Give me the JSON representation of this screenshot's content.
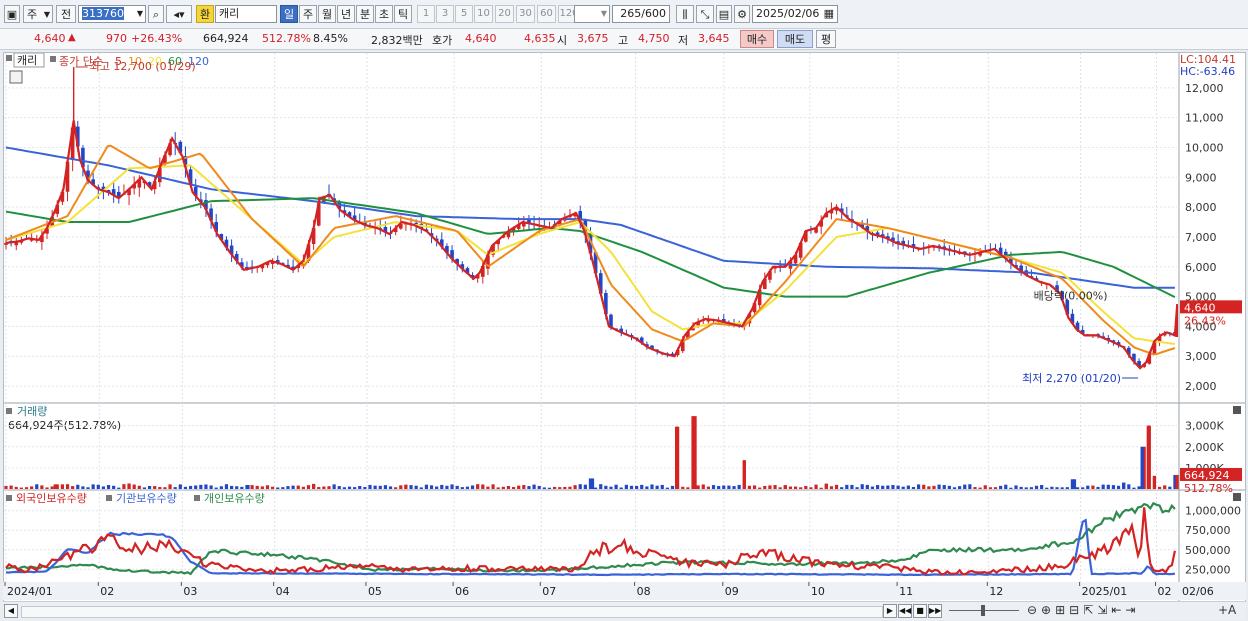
{
  "toolbar": {
    "market": "주",
    "scope": "전",
    "code": "313760",
    "currency": "환",
    "name": "캐리",
    "periods": [
      "일",
      "주",
      "월",
      "년",
      "분",
      "초",
      "틱"
    ],
    "active_period": "일",
    "minutes": [
      "1",
      "3",
      "5",
      "10",
      "20",
      "30",
      "60",
      "120"
    ],
    "count": "265",
    "count_total": "/600",
    "date": "2025/02/06"
  },
  "price_row": {
    "price": "4,640",
    "change": "970",
    "change_pct": "+26.43%",
    "volume": "664,924",
    "volume_pct": "512.78%",
    "turnover": "8.45%",
    "amount": "2,832백만",
    "quote_label": "호가",
    "ask": "4,640",
    "bid": "4,635",
    "open_label": "시",
    "open": "3,675",
    "high_label": "고",
    "high": "4,750",
    "low_label": "저",
    "low": "3,645",
    "buy": "매수",
    "sell": "매도",
    "eval": "평"
  },
  "chart_data": [
    {
      "type": "line",
      "title": "캐리",
      "legend_label": "종가 단순",
      "ma_periods": [
        "5",
        "10",
        "20",
        "60",
        "120"
      ],
      "colors": {
        "ma5": "#d32323",
        "ma10": "#f08a1c",
        "ma20": "#f4e23a",
        "ma60": "#209040",
        "ma120": "#3a63d8",
        "up": "#d32323",
        "down": "#1f47c8"
      },
      "ylim": [
        1600,
        12900
      ],
      "y_ticks": [
        "12,000",
        "11,000",
        "10,000",
        "9,000",
        "8,000",
        "7,000",
        "6,000",
        "5,000",
        "4,000",
        "3,000",
        "2,000"
      ],
      "y_tick_values": [
        12000,
        11000,
        10000,
        9000,
        8000,
        7000,
        6000,
        5000,
        4000,
        3000,
        2000
      ],
      "x_labels": [
        "2024/01",
        "02",
        "03",
        "04",
        "05",
        "06",
        "07",
        "08",
        "09",
        "10",
        "11",
        "12",
        "2025/01",
        "02",
        "02/06"
      ],
      "lc": "LC:104.41",
      "hc": "HC:-63.46",
      "last_price": "4,640",
      "last_pct": "26.43%",
      "max_annotation": "최고 12,700 (01/29)",
      "min_annotation": "최저 2,270 (01/20)",
      "dividend_annotation": "배당락(0.00%)",
      "close_keys": [
        [
          0,
          6800
        ],
        [
          12,
          6850
        ],
        [
          22,
          6950
        ],
        [
          32,
          6900
        ],
        [
          40,
          7300
        ],
        [
          48,
          7900
        ],
        [
          56,
          8600
        ],
        [
          66,
          10900
        ],
        [
          72,
          9600
        ],
        [
          80,
          8900
        ],
        [
          90,
          8600
        ],
        [
          100,
          8500
        ],
        [
          110,
          8300
        ],
        [
          120,
          8600
        ],
        [
          132,
          9000
        ],
        [
          142,
          8600
        ],
        [
          152,
          9500
        ],
        [
          162,
          10300
        ],
        [
          172,
          9700
        ],
        [
          182,
          8500
        ],
        [
          194,
          8000
        ],
        [
          206,
          7100
        ],
        [
          218,
          6500
        ],
        [
          232,
          5900
        ],
        [
          246,
          6000
        ],
        [
          258,
          6200
        ],
        [
          268,
          6100
        ],
        [
          280,
          5900
        ],
        [
          290,
          6200
        ],
        [
          300,
          7300
        ],
        [
          306,
          8300
        ],
        [
          316,
          8400
        ],
        [
          326,
          7900
        ],
        [
          338,
          7600
        ],
        [
          350,
          7400
        ],
        [
          362,
          7300
        ],
        [
          374,
          7100
        ],
        [
          386,
          7500
        ],
        [
          398,
          7400
        ],
        [
          410,
          7200
        ],
        [
          422,
          6800
        ],
        [
          434,
          6300
        ],
        [
          446,
          5900
        ],
        [
          456,
          5600
        ],
        [
          462,
          5800
        ],
        [
          474,
          6700
        ],
        [
          490,
          7200
        ],
        [
          504,
          7500
        ],
        [
          518,
          7400
        ],
        [
          532,
          7300
        ],
        [
          542,
          7600
        ],
        [
          556,
          7800
        ],
        [
          564,
          7200
        ],
        [
          572,
          6200
        ],
        [
          580,
          5100
        ],
        [
          588,
          4000
        ],
        [
          600,
          3800
        ],
        [
          614,
          3600
        ],
        [
          626,
          3300
        ],
        [
          640,
          3100
        ],
        [
          652,
          3000
        ],
        [
          662,
          3700
        ],
        [
          672,
          4100
        ],
        [
          682,
          4250
        ],
        [
          694,
          4200
        ],
        [
          706,
          4100
        ],
        [
          718,
          4000
        ],
        [
          728,
          4600
        ],
        [
          738,
          5500
        ],
        [
          748,
          6000
        ],
        [
          760,
          6000
        ],
        [
          770,
          6400
        ],
        [
          780,
          7200
        ],
        [
          790,
          7300
        ],
        [
          800,
          7800
        ],
        [
          810,
          8000
        ],
        [
          822,
          7600
        ],
        [
          832,
          7400
        ],
        [
          844,
          7100
        ],
        [
          856,
          7000
        ],
        [
          868,
          6800
        ],
        [
          880,
          6700
        ],
        [
          892,
          6600
        ],
        [
          904,
          6700
        ],
        [
          916,
          6600
        ],
        [
          928,
          6500
        ],
        [
          940,
          6400
        ],
        [
          952,
          6500
        ],
        [
          964,
          6600
        ],
        [
          974,
          6300
        ],
        [
          984,
          6000
        ],
        [
          996,
          5700
        ],
        [
          1008,
          5500
        ],
        [
          1018,
          5400
        ],
        [
          1028,
          5100
        ],
        [
          1036,
          4300
        ],
        [
          1044,
          3900
        ],
        [
          1052,
          3700
        ],
        [
          1064,
          3700
        ],
        [
          1078,
          3500
        ],
        [
          1090,
          3300
        ],
        [
          1098,
          2900
        ],
        [
          1106,
          2600
        ],
        [
          1112,
          2800
        ],
        [
          1120,
          3500
        ],
        [
          1126,
          3700
        ],
        [
          1132,
          3800
        ],
        [
          1140,
          3700
        ],
        [
          1142,
          4640
        ]
      ],
      "ma120_keys": [
        [
          0,
          10000
        ],
        [
          100,
          9400
        ],
        [
          200,
          8600
        ],
        [
          300,
          8200
        ],
        [
          400,
          7700
        ],
        [
          500,
          7600
        ],
        [
          560,
          7600
        ],
        [
          600,
          7400
        ],
        [
          700,
          6200
        ],
        [
          800,
          6000
        ],
        [
          900,
          5950
        ],
        [
          1000,
          5800
        ],
        [
          1100,
          5300
        ],
        [
          1142,
          5300
        ]
      ],
      "ma60_keys": [
        [
          0,
          7850
        ],
        [
          60,
          7500
        ],
        [
          120,
          7500
        ],
        [
          200,
          8200
        ],
        [
          300,
          8300
        ],
        [
          400,
          7800
        ],
        [
          470,
          7100
        ],
        [
          530,
          7300
        ],
        [
          560,
          7200
        ],
        [
          620,
          6500
        ],
        [
          700,
          5300
        ],
        [
          760,
          5000
        ],
        [
          820,
          5000
        ],
        [
          900,
          5800
        ],
        [
          980,
          6400
        ],
        [
          1030,
          6500
        ],
        [
          1080,
          6000
        ],
        [
          1142,
          4950
        ]
      ],
      "ma20_keys": [
        [
          0,
          6900
        ],
        [
          60,
          7500
        ],
        [
          120,
          9300
        ],
        [
          180,
          9400
        ],
        [
          240,
          7600
        ],
        [
          290,
          6100
        ],
        [
          320,
          7000
        ],
        [
          380,
          7500
        ],
        [
          440,
          7200
        ],
        [
          470,
          6400
        ],
        [
          520,
          7100
        ],
        [
          560,
          7500
        ],
        [
          590,
          6500
        ],
        [
          630,
          4500
        ],
        [
          660,
          3900
        ],
        [
          690,
          4100
        ],
        [
          720,
          4100
        ],
        [
          760,
          5200
        ],
        [
          810,
          7000
        ],
        [
          860,
          7300
        ],
        [
          920,
          6800
        ],
        [
          980,
          6300
        ],
        [
          1030,
          5800
        ],
        [
          1070,
          4500
        ],
        [
          1100,
          3600
        ],
        [
          1142,
          3400
        ]
      ],
      "ma10_keys": [
        [
          0,
          6900
        ],
        [
          60,
          7700
        ],
        [
          100,
          10100
        ],
        [
          140,
          9300
        ],
        [
          190,
          9800
        ],
        [
          240,
          7600
        ],
        [
          290,
          6000
        ],
        [
          320,
          7300
        ],
        [
          380,
          7700
        ],
        [
          440,
          7200
        ],
        [
          470,
          6000
        ],
        [
          520,
          7200
        ],
        [
          560,
          7600
        ],
        [
          590,
          5400
        ],
        [
          630,
          3900
        ],
        [
          660,
          3500
        ],
        [
          690,
          4100
        ],
        [
          720,
          4000
        ],
        [
          760,
          5500
        ],
        [
          810,
          7600
        ],
        [
          860,
          7300
        ],
        [
          920,
          6800
        ],
        [
          980,
          6300
        ],
        [
          1030,
          5600
        ],
        [
          1070,
          4200
        ],
        [
          1100,
          3300
        ],
        [
          1120,
          3050
        ],
        [
          1142,
          3300
        ]
      ]
    },
    {
      "type": "bar",
      "title": "거래량",
      "volume_readout": "664,924주(512.78%)",
      "ylim": [
        0,
        3600
      ],
      "y_ticks": [
        "3,000K",
        "2,000K",
        "1,000K"
      ],
      "y_tick_values": [
        3000,
        2000,
        1000
      ],
      "last_label": "664,924",
      "last_pct": "512.78%",
      "spikes": [
        [
          48,
          220
        ],
        [
          120,
          260
        ],
        [
          236,
          190
        ],
        [
          300,
          240
        ],
        [
          390,
          200
        ],
        [
          572,
          500
        ],
        [
          654,
          2950
        ],
        [
          672,
          3450
        ],
        [
          720,
          1360
        ],
        [
          760,
          180
        ],
        [
          800,
          250
        ],
        [
          1042,
          460
        ],
        [
          1090,
          300
        ],
        [
          1108,
          2000
        ],
        [
          1114,
          3000
        ],
        [
          1120,
          620
        ],
        [
          1142,
          665
        ]
      ]
    },
    {
      "type": "line",
      "series_names": [
        "외국인보유수량",
        "기관보유수량",
        "개인보유수량"
      ],
      "colors": {
        "foreign": "#d32323",
        "inst": "#3a63d8",
        "indiv": "#2f8a4f"
      },
      "ylim": [
        100000,
        1150000
      ],
      "y_ticks": [
        "1,000,000",
        "750,000",
        "500,000",
        "250,000"
      ],
      "y_tick_values": [
        1000000,
        750000,
        500000,
        250000
      ],
      "foreign_keys": [
        [
          0,
          290000
        ],
        [
          20,
          240000
        ],
        [
          40,
          300000
        ],
        [
          60,
          420000
        ],
        [
          80,
          520000
        ],
        [
          100,
          620000
        ],
        [
          120,
          500000
        ],
        [
          140,
          520000
        ],
        [
          160,
          560000
        ],
        [
          180,
          410000
        ],
        [
          200,
          300000
        ],
        [
          220,
          280000
        ],
        [
          260,
          230000
        ],
        [
          300,
          250000
        ],
        [
          340,
          290000
        ],
        [
          400,
          240000
        ],
        [
          440,
          260000
        ],
        [
          500,
          250000
        ],
        [
          560,
          250000
        ],
        [
          575,
          500000
        ],
        [
          600,
          550000
        ],
        [
          640,
          410000
        ],
        [
          660,
          340000
        ],
        [
          700,
          300000
        ],
        [
          720,
          420000
        ],
        [
          740,
          470000
        ],
        [
          760,
          420000
        ],
        [
          800,
          300000
        ],
        [
          850,
          290000
        ],
        [
          900,
          220000
        ],
        [
          950,
          200000
        ],
        [
          1000,
          260000
        ],
        [
          1030,
          300000
        ],
        [
          1050,
          400000
        ],
        [
          1070,
          490000
        ],
        [
          1085,
          600000
        ],
        [
          1095,
          730000
        ],
        [
          1100,
          800000
        ],
        [
          1105,
          400000
        ],
        [
          1110,
          940000
        ],
        [
          1115,
          310000
        ],
        [
          1120,
          260000
        ],
        [
          1130,
          230000
        ],
        [
          1138,
          270000
        ],
        [
          1142,
          800000
        ]
      ],
      "inst_keys": [
        [
          0,
          210000
        ],
        [
          40,
          220000
        ],
        [
          60,
          500000
        ],
        [
          80,
          460000
        ],
        [
          100,
          700000
        ],
        [
          130,
          700000
        ],
        [
          160,
          680000
        ],
        [
          180,
          350000
        ],
        [
          200,
          200000
        ],
        [
          400,
          190000
        ],
        [
          600,
          180000
        ],
        [
          700,
          190000
        ],
        [
          900,
          180000
        ],
        [
          1040,
          190000
        ],
        [
          1052,
          1000000
        ],
        [
          1058,
          190000
        ],
        [
          1108,
          200000
        ],
        [
          1114,
          300000
        ],
        [
          1120,
          190000
        ],
        [
          1142,
          190000
        ]
      ],
      "indiv_keys": [
        [
          0,
          260000
        ],
        [
          40,
          280000
        ],
        [
          80,
          300000
        ],
        [
          120,
          230000
        ],
        [
          180,
          200000
        ],
        [
          200,
          480000
        ],
        [
          240,
          460000
        ],
        [
          300,
          380000
        ],
        [
          360,
          240000
        ],
        [
          420,
          260000
        ],
        [
          480,
          230000
        ],
        [
          540,
          240000
        ],
        [
          600,
          300000
        ],
        [
          660,
          340000
        ],
        [
          720,
          330000
        ],
        [
          780,
          320000
        ],
        [
          840,
          330000
        ],
        [
          880,
          380000
        ],
        [
          900,
          500000
        ],
        [
          960,
          500000
        ],
        [
          1000,
          520000
        ],
        [
          1040,
          600000
        ],
        [
          1060,
          780000
        ],
        [
          1080,
          920000
        ],
        [
          1100,
          1000000
        ],
        [
          1110,
          1050000
        ],
        [
          1125,
          1040000
        ],
        [
          1142,
          1000000
        ]
      ]
    }
  ]
}
